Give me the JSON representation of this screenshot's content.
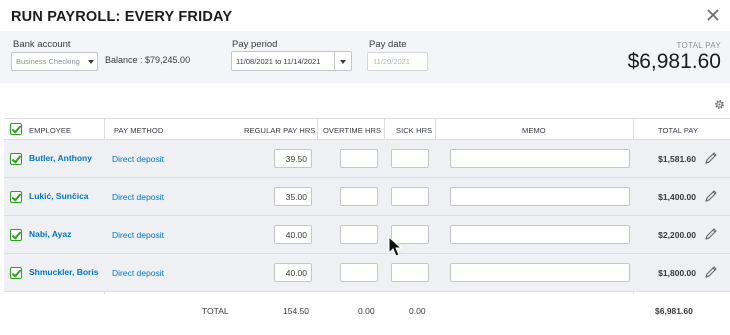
{
  "header": {
    "title": "RUN PAYROLL: EVERY FRIDAY"
  },
  "settings": {
    "bank_account_label": "Bank account",
    "bank_account_value": "Business Checking",
    "balance_text": "Balance : $79,245.00",
    "pay_period_label": "Pay period",
    "pay_period_value": "11/08/2021 to 11/14/2021",
    "pay_date_label": "Pay date",
    "pay_date_value": "11/20/2021",
    "total_pay_label": "TOTAL PAY",
    "total_pay_amount": "$6,981.60"
  },
  "table": {
    "headers": {
      "employee": "EMPLOYEE",
      "pay_method": "PAY METHOD",
      "regular_hrs": "REGULAR PAY HRS",
      "overtime_hrs": "OVERTIME HRS",
      "sick_hrs": "SICK HRS",
      "memo": "MEMO",
      "total_pay": "TOTAL PAY"
    },
    "rows": [
      {
        "name": "Butler, Anthony",
        "method": "Direct deposit",
        "regular": "39.50",
        "overtime": "",
        "sick": "",
        "memo": "",
        "total": "$1,581.60"
      },
      {
        "name": "Lukić, Sunčica",
        "method": "Direct deposit",
        "regular": "35.00",
        "overtime": "",
        "sick": "",
        "memo": "",
        "total": "$1,400.00"
      },
      {
        "name": "Nabi, Ayaz",
        "method": "Direct deposit",
        "regular": "40.00",
        "overtime": "",
        "sick": "",
        "memo": "",
        "total": "$2,200.00"
      },
      {
        "name": "Shmuckler, Boris",
        "method": "Direct deposit",
        "regular": "40.00",
        "overtime": "",
        "sick": "",
        "memo": "",
        "total": "$1,800.00"
      }
    ],
    "totals": {
      "label": "TOTAL",
      "regular": "154.50",
      "overtime": "0.00",
      "sick": "0.00",
      "total": "$6,981.60"
    }
  },
  "icons": {
    "close": "close-icon",
    "settings": "gear-icon",
    "edit": "pencil-icon",
    "dropdown": "chevron-down-icon",
    "checkbox": "checkbox-checked-icon",
    "cursor": "mouse-pointer-icon"
  },
  "colors": {
    "accent_green": "#2ca01c",
    "link_blue": "#0077c5",
    "row_band": "#eef0f4",
    "settings_band": "#f4f5f8"
  }
}
